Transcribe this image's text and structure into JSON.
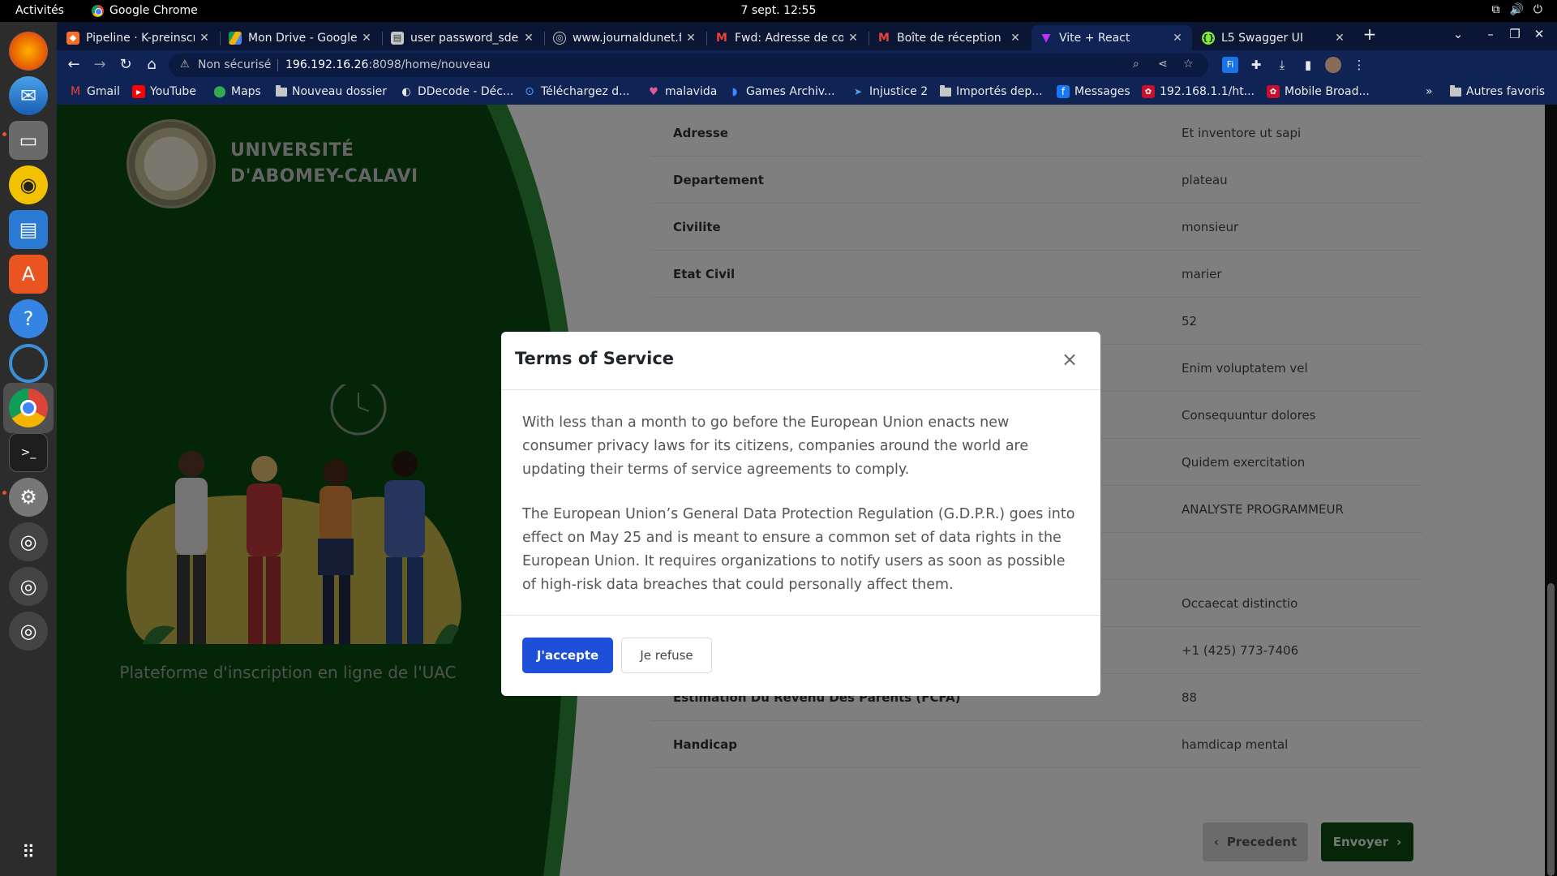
{
  "topbar": {
    "activities": "Activités",
    "app_name": "Google Chrome",
    "clock": "7 sept.  12:55"
  },
  "tabs": [
    {
      "title": "Pipeline · K-preinscri",
      "icon": "gitlab-icon"
    },
    {
      "title": "Mon Drive - Google D",
      "icon": "google-drive-icon"
    },
    {
      "title": "user password_sdep",
      "icon": "document-icon"
    },
    {
      "title": "www.journaldunet.fr",
      "icon": "globe-icon"
    },
    {
      "title": "Fwd: Adresse de con",
      "icon": "gmail-icon"
    },
    {
      "title": "Boîte de réception (",
      "icon": "gmail-icon"
    },
    {
      "title": "Vite + React",
      "icon": "vite-icon"
    },
    {
      "title": "L5 Swagger UI",
      "icon": "swagger-icon"
    }
  ],
  "omnibox": {
    "security": "Non sécurisé",
    "host": "196.192.16.26",
    "path": ":8098/home/nouveau"
  },
  "bookmarks": [
    {
      "label": "Gmail",
      "icon": "gmail-icon"
    },
    {
      "label": "YouTube",
      "icon": "youtube-icon"
    },
    {
      "label": "Maps",
      "icon": "maps-icon"
    },
    {
      "label": "Nouveau dossier",
      "icon": "folder-icon"
    },
    {
      "label": "DDecode - Déc...",
      "icon": "ddecode-icon"
    },
    {
      "label": "Téléchargez d...",
      "icon": "download-site-icon"
    },
    {
      "label": "malavida",
      "icon": "malavida-icon"
    },
    {
      "label": "Games Archiv...",
      "icon": "games-icon"
    },
    {
      "label": "Injustice 2",
      "icon": "injustice-icon"
    },
    {
      "label": "Importés dep...",
      "icon": "folder-icon"
    },
    {
      "label": "Messages",
      "icon": "facebook-icon"
    },
    {
      "label": "192.168.1.1/ht...",
      "icon": "huawei-icon"
    },
    {
      "label": "Mobile Broad...",
      "icon": "huawei-icon"
    }
  ],
  "bookmarks_other": "Autres favoris",
  "university": {
    "name_line1": "UNIVERSITÉ",
    "name_line2": "D'ABOMEY-CALAVI",
    "platform": "Plateforme d'inscription en ligne de l'UAC"
  },
  "details": [
    {
      "label": "Adresse",
      "value": "Et inventore ut sapi"
    },
    {
      "label": "Departement",
      "value": "plateau"
    },
    {
      "label": "Civilite",
      "value": "monsieur"
    },
    {
      "label": "Etat Civil",
      "value": "marier"
    },
    {
      "label": "",
      "value": "52"
    },
    {
      "label": "",
      "value": "Enim voluptatem vel"
    },
    {
      "label": "",
      "value": "Consequuntur dolores"
    },
    {
      "label": "",
      "value": "Quidem exercitation"
    },
    {
      "label": "",
      "value": "ANALYSTE PROGRAMMEUR"
    },
    {
      "label": "",
      "value": ""
    },
    {
      "label": "",
      "value": "Occaecat distinctio"
    },
    {
      "label": "",
      "value": "+1 (425) 773-7406"
    },
    {
      "label": "Estimation Du Revenu Des Parents (FCFA)",
      "value": "88"
    },
    {
      "label": "Handicap",
      "value": "hamdicap mental"
    }
  ],
  "buttons": {
    "previous": "Precedent",
    "send": "Envoyer"
  },
  "modal": {
    "title": "Terms of Service",
    "paragraph1": "With less than a month to go before the European Union enacts new consumer privacy laws for its citizens, companies around the world are updating their terms of service agreements to comply.",
    "paragraph2": "The European Union’s General Data Protection Regulation (G.D.P.R.) goes into effect on May 25 and is meant to ensure a common set of data rights in the European Union. It requires organizations to notify users as soon as possible of high-risk data breaches that could personally affect them.",
    "accept": "J'accepte",
    "refuse": "Je refuse"
  },
  "colors": {
    "uac_green": "#0b4a10",
    "accept_blue": "#1d4fd8",
    "chrome_frame": "#0f2454"
  }
}
